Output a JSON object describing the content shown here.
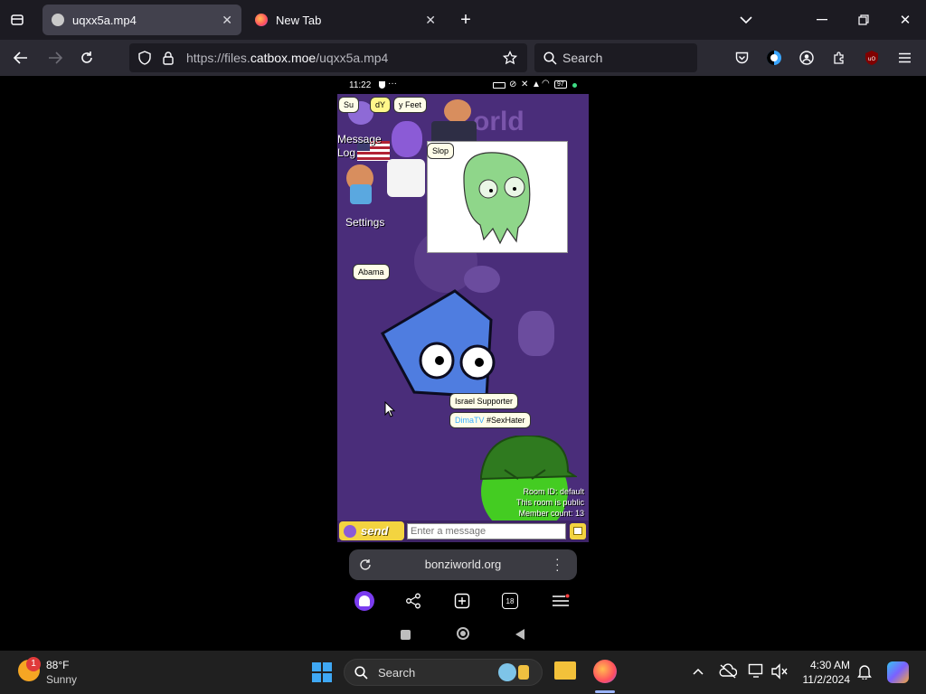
{
  "browser": {
    "tabs": [
      {
        "label": "uqxx5a.mp4",
        "active": true
      },
      {
        "label": "New Tab",
        "active": false
      }
    ],
    "url": {
      "prefix": "https://files.",
      "domain": "catbox.moe",
      "path": "/uqxx5a.mp4"
    },
    "search_placeholder": "Search"
  },
  "phone": {
    "status_time": "11:22",
    "battery": "97",
    "game": {
      "bubbles": {
        "top_left": "Su",
        "top_mid": "dY",
        "feet": "y Feet",
        "slop": "Slop",
        "abama": "Abama",
        "israel": "Israel Supporter",
        "dima_name": "DimaTV",
        "dima_msg": "#SexHater"
      },
      "logo": "orld",
      "menu": {
        "message": "Message",
        "log": "Log",
        "settings": "Settings"
      },
      "room_info": {
        "room_id": "Room ID: default",
        "public": "This room is public",
        "member_count": "Member count: 13"
      }
    },
    "chat": {
      "send_label": "send",
      "placeholder": "Enter a message"
    },
    "mobile_url": "bonziworld.org",
    "tab_count": "18"
  },
  "taskbar": {
    "weather_temp": "88°F",
    "weather_desc": "Sunny",
    "weather_badge": "1",
    "search_placeholder": "Search",
    "time": "4:30 AM",
    "date": "11/2/2024"
  },
  "colors": {
    "game_bg": "#4a2d7a",
    "accent_blue": "#4f7de0",
    "green": "#44cc22",
    "taskbar": "#202020"
  }
}
